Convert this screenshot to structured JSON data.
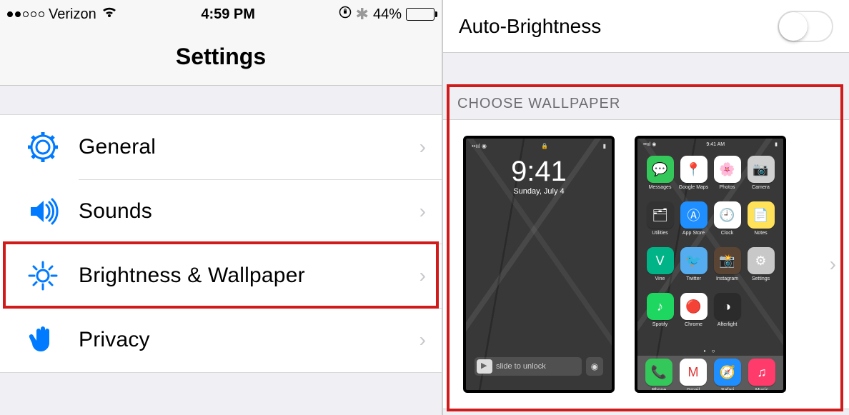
{
  "status_bar": {
    "carrier": "Verizon",
    "time": "4:59 PM",
    "battery_pct": "44%"
  },
  "nav": {
    "title": "Settings"
  },
  "rows": {
    "general": "General",
    "sounds": "Sounds",
    "brightness": "Brightness & Wallpaper",
    "privacy": "Privacy"
  },
  "right": {
    "auto_brightness": "Auto-Brightness",
    "choose_wallpaper": "CHOOSE WALLPAPER"
  },
  "lock_preview": {
    "time": "9:41",
    "date": "Sunday, July 4",
    "slide": "slide to unlock"
  },
  "home_preview": {
    "status_time": "9:41 AM",
    "apps": [
      {
        "label": "Messages",
        "bg": "#34c759",
        "glyph": "💬"
      },
      {
        "label": "Google Maps",
        "bg": "#ffffff",
        "glyph": "📍"
      },
      {
        "label": "Photos",
        "bg": "#ffffff",
        "glyph": "🌸"
      },
      {
        "label": "Camera",
        "bg": "#d0d0d0",
        "glyph": "📷"
      },
      {
        "label": "Utilities",
        "bg": "#333333",
        "glyph": "🗂"
      },
      {
        "label": "App Store",
        "bg": "#1f8fff",
        "glyph": "Ⓐ"
      },
      {
        "label": "Clock",
        "bg": "#ffffff",
        "glyph": "🕘"
      },
      {
        "label": "Notes",
        "bg": "#ffe15a",
        "glyph": "📄"
      },
      {
        "label": "Vine",
        "bg": "#00b488",
        "glyph": "V"
      },
      {
        "label": "Twitter",
        "bg": "#55acee",
        "glyph": "🐦"
      },
      {
        "label": "Instagram",
        "bg": "#5a4535",
        "glyph": "📸"
      },
      {
        "label": "Settings",
        "bg": "#c8c8c8",
        "glyph": "⚙"
      },
      {
        "label": "Spotify",
        "bg": "#1ed760",
        "glyph": "♪"
      },
      {
        "label": "Chrome",
        "bg": "#ffffff",
        "glyph": "🔴"
      },
      {
        "label": "Afterlight",
        "bg": "#2b2b2b",
        "glyph": "◑"
      }
    ],
    "dock": [
      {
        "label": "Phone",
        "bg": "#34c759",
        "glyph": "📞"
      },
      {
        "label": "Gmail",
        "bg": "#ffffff",
        "glyph": "M"
      },
      {
        "label": "Safari",
        "bg": "#1f8fff",
        "glyph": "🧭"
      },
      {
        "label": "Music",
        "bg": "#ff3b6b",
        "glyph": "♫"
      }
    ]
  }
}
